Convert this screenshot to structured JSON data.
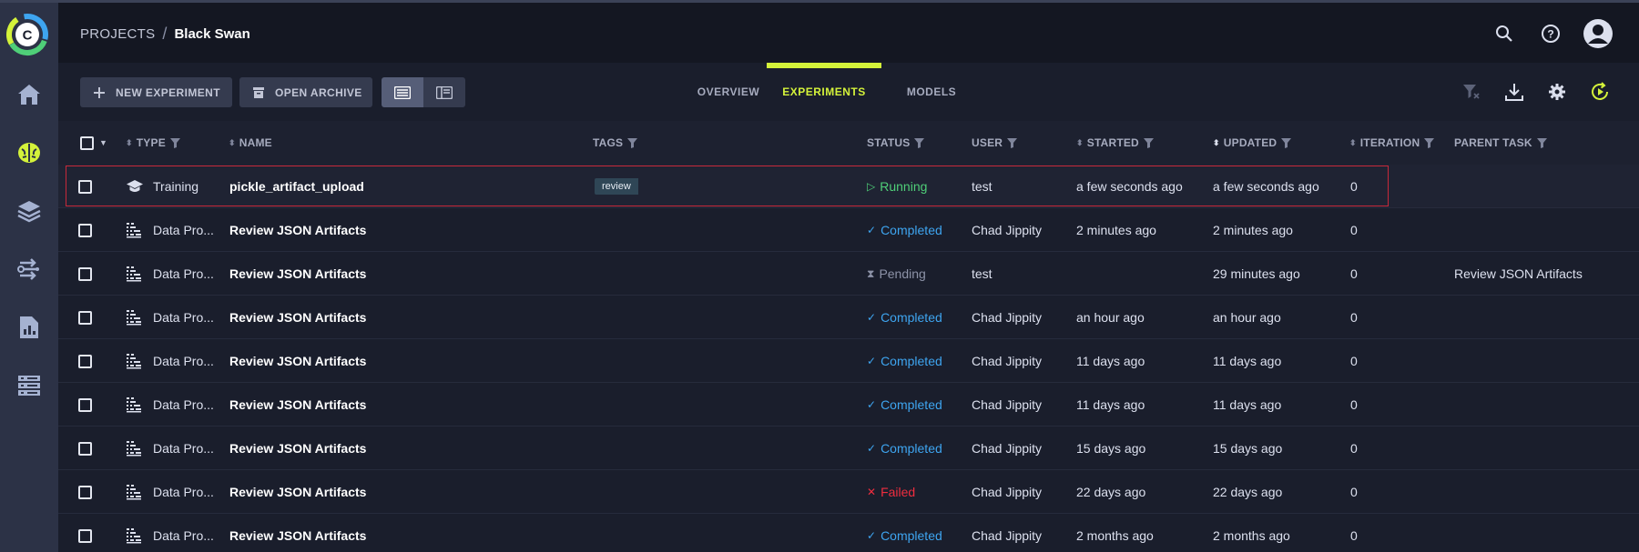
{
  "header": {
    "breadcrumb_root": "PROJECTS",
    "breadcrumb_sep": "/",
    "project_name": "Black Swan"
  },
  "toolbar": {
    "new_experiment": "NEW EXPERIMENT",
    "open_archive": "OPEN ARCHIVE"
  },
  "tabs": [
    "OVERVIEW",
    "EXPERIMENTS",
    "MODELS"
  ],
  "active_tab": "EXPERIMENTS",
  "colors": {
    "accent": "#d4f23a",
    "running": "#4fcf78",
    "completed": "#3ea5f0",
    "failed": "#ee2d3f",
    "pending": "#8d93a8",
    "highlight": "#c7293a"
  },
  "table": {
    "columns": {
      "type": "TYPE",
      "name": "NAME",
      "tags": "TAGS",
      "status": "STATUS",
      "user": "USER",
      "started": "STARTED",
      "updated": "UPDATED",
      "iteration": "ITERATION",
      "parent": "PARENT TASK"
    },
    "rows": [
      {
        "type": "Training",
        "type_icon": "graduation-cap-icon",
        "name": "pickle_artifact_upload",
        "tag": "review",
        "status": "Running",
        "status_icon": "play-icon",
        "status_class": "running",
        "user": "test",
        "started": "a few seconds ago",
        "updated": "a few seconds ago",
        "iteration": "0",
        "parent": ""
      },
      {
        "type": "Data Pro...",
        "type_icon": "data-processing-icon",
        "name": "Review JSON Artifacts",
        "tag": "",
        "status": "Completed",
        "status_icon": "check-icon",
        "status_class": "completed",
        "user": "Chad Jippity",
        "started": "2 minutes ago",
        "updated": "2 minutes ago",
        "iteration": "0",
        "parent": ""
      },
      {
        "type": "Data Pro...",
        "type_icon": "data-processing-icon",
        "name": "Review JSON Artifacts",
        "tag": "",
        "status": "Pending",
        "status_icon": "hourglass-icon",
        "status_class": "pending",
        "user": "test",
        "started": "",
        "updated": "29 minutes ago",
        "iteration": "0",
        "parent": "Review JSON Artifacts"
      },
      {
        "type": "Data Pro...",
        "type_icon": "data-processing-icon",
        "name": "Review JSON Artifacts",
        "tag": "",
        "status": "Completed",
        "status_icon": "check-icon",
        "status_class": "completed",
        "user": "Chad Jippity",
        "started": "an hour ago",
        "updated": "an hour ago",
        "iteration": "0",
        "parent": ""
      },
      {
        "type": "Data Pro...",
        "type_icon": "data-processing-icon",
        "name": "Review JSON Artifacts",
        "tag": "",
        "status": "Completed",
        "status_icon": "check-icon",
        "status_class": "completed",
        "user": "Chad Jippity",
        "started": "11 days ago",
        "updated": "11 days ago",
        "iteration": "0",
        "parent": ""
      },
      {
        "type": "Data Pro...",
        "type_icon": "data-processing-icon",
        "name": "Review JSON Artifacts",
        "tag": "",
        "status": "Completed",
        "status_icon": "check-icon",
        "status_class": "completed",
        "user": "Chad Jippity",
        "started": "11 days ago",
        "updated": "11 days ago",
        "iteration": "0",
        "parent": ""
      },
      {
        "type": "Data Pro...",
        "type_icon": "data-processing-icon",
        "name": "Review JSON Artifacts",
        "tag": "",
        "status": "Completed",
        "status_icon": "check-icon",
        "status_class": "completed",
        "user": "Chad Jippity",
        "started": "15 days ago",
        "updated": "15 days ago",
        "iteration": "0",
        "parent": ""
      },
      {
        "type": "Data Pro...",
        "type_icon": "data-processing-icon",
        "name": "Review JSON Artifacts",
        "tag": "",
        "status": "Failed",
        "status_icon": "x-icon",
        "status_class": "failed",
        "user": "Chad Jippity",
        "started": "22 days ago",
        "updated": "22 days ago",
        "iteration": "0",
        "parent": ""
      },
      {
        "type": "Data Pro...",
        "type_icon": "data-processing-icon",
        "name": "Review JSON Artifacts",
        "tag": "",
        "status": "Completed",
        "status_icon": "check-icon",
        "status_class": "completed",
        "user": "Chad Jippity",
        "started": "2 months ago",
        "updated": "2 months ago",
        "iteration": "0",
        "parent": ""
      }
    ]
  }
}
